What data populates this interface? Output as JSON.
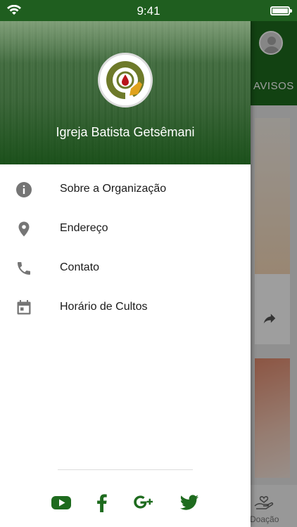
{
  "status_bar": {
    "time": "9:41"
  },
  "drawer": {
    "org_name": "Igreja Batista Getsêmani",
    "menu": [
      {
        "label": "Sobre a Organização",
        "icon": "info-icon"
      },
      {
        "label": "Endereço",
        "icon": "location-pin-icon"
      },
      {
        "label": "Contato",
        "icon": "phone-icon"
      },
      {
        "label": "Horário de Cultos",
        "icon": "calendar-icon"
      }
    ],
    "social": [
      "youtube-icon",
      "facebook-icon",
      "google-plus-icon",
      "twitter-icon"
    ]
  },
  "background_app": {
    "tab_label": "AVISOS",
    "bottom_nav": {
      "doacao_label": "Doação"
    }
  },
  "colors": {
    "brand_green": "#1d6b1d",
    "icon_gray": "#757575",
    "social_green": "#1e6b1e"
  }
}
